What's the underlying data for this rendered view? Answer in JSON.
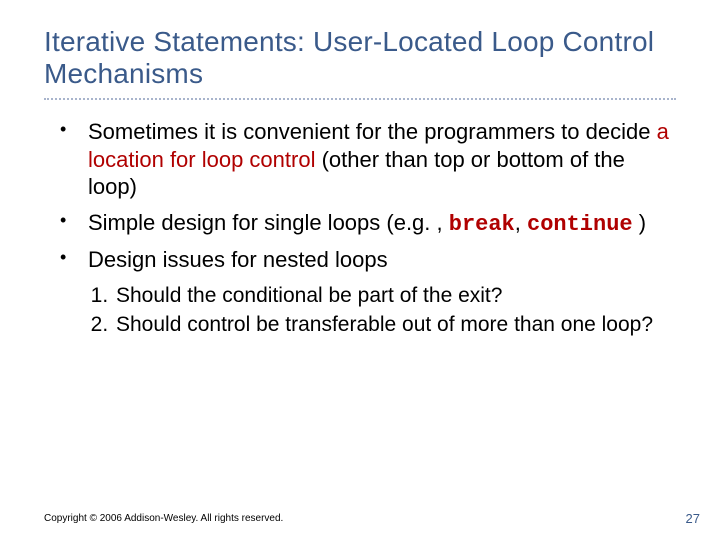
{
  "title": "Iterative Statements: User-Located Loop Control Mechanisms",
  "b1_a": "Sometimes it is convenient for the programmers to decide ",
  "b1_hl": "a location for loop control",
  "b1_b": " (other than top or bottom of the loop)",
  "b2_a": "Simple design for single loops (e.g. , ",
  "b2_kw1": "break",
  "b2_mid": ", ",
  "b2_kw2": "continue",
  "b2_b": " )",
  "b3": "Design issues for nested loops",
  "s1": "Should the conditional be part of the exit?",
  "s2": "Should control be transferable out of more than one loop?",
  "copyright": "Copyright © 2006 Addison-Wesley. All rights reserved.",
  "page": "27"
}
